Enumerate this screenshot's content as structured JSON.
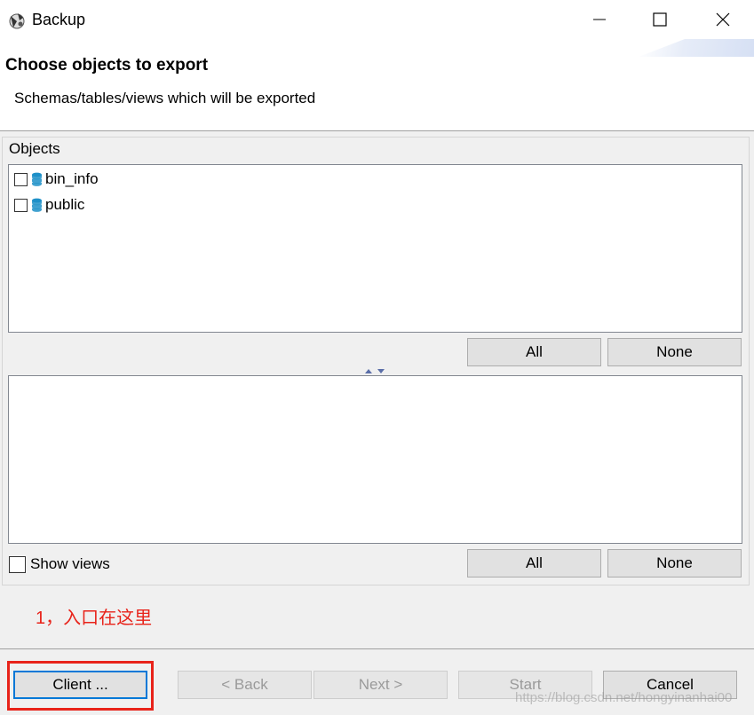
{
  "window": {
    "title": "Backup",
    "icon": "backup-app-icon",
    "controls": [
      "minimize-icon",
      "maximize-icon",
      "close-icon"
    ]
  },
  "header": {
    "title": "Choose objects to export",
    "description": "Schemas/tables/views which will be exported"
  },
  "objects": {
    "group_label": "Objects",
    "items": [
      {
        "label": "bin_info",
        "checked": false,
        "icon": "database-schema-icon"
      },
      {
        "label": "public",
        "checked": false,
        "icon": "database-schema-icon"
      }
    ],
    "all_label": "All",
    "none_label": "None"
  },
  "tables": {
    "items": [],
    "all_label": "All",
    "none_label": "None",
    "show_views_label": "Show views",
    "show_views_checked": false
  },
  "annotation": {
    "text": "1，入口在这里",
    "color": "#e8231a"
  },
  "footer": {
    "client_label": "Client ...",
    "back_label": "< Back",
    "next_label": "Next >",
    "start_label": "Start",
    "cancel_label": "Cancel"
  },
  "watermark": "https://blog.csdn.net/hongyinanhai00",
  "colors": {
    "accent": "#0078d7",
    "schema_icon": "#1e90c8",
    "annotation": "#e8231a"
  }
}
